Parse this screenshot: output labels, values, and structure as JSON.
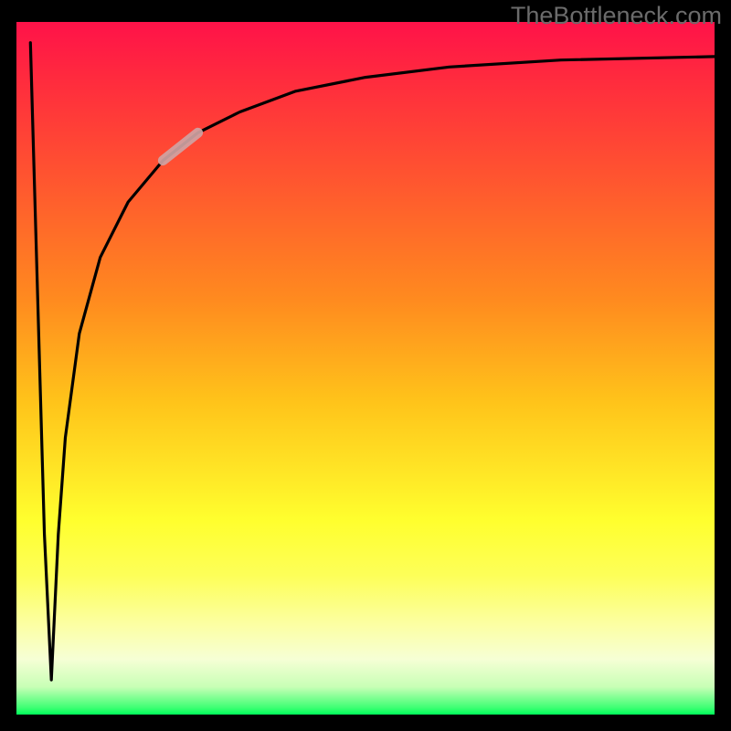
{
  "watermark": "TheBottleneck.com",
  "chart_data": {
    "type": "line",
    "title": "",
    "xlabel": "",
    "ylabel": "",
    "xlim": [
      0,
      100
    ],
    "ylim": [
      0,
      100
    ],
    "grid": false,
    "legend": false,
    "series": [
      {
        "name": "main-curve",
        "x": [
          2,
          4,
          5,
          6,
          7,
          9,
          12,
          16,
          21,
          26,
          32,
          40,
          50,
          62,
          78,
          100
        ],
        "y": [
          97,
          26,
          5,
          26,
          40,
          55,
          66,
          74,
          80,
          84,
          87,
          90,
          92,
          93.5,
          94.5,
          95
        ]
      },
      {
        "name": "highlight-segment",
        "x": [
          21,
          26
        ],
        "y": [
          80,
          84
        ]
      }
    ],
    "background_gradient": {
      "direction": "vertical",
      "stops": [
        {
          "pos": 0.0,
          "color": "#ff1249"
        },
        {
          "pos": 0.08,
          "color": "#ff2a3e"
        },
        {
          "pos": 0.22,
          "color": "#ff5330"
        },
        {
          "pos": 0.4,
          "color": "#ff8a1f"
        },
        {
          "pos": 0.55,
          "color": "#ffc41a"
        },
        {
          "pos": 0.65,
          "color": "#ffe626"
        },
        {
          "pos": 0.72,
          "color": "#ffff2e"
        },
        {
          "pos": 0.8,
          "color": "#fdff59"
        },
        {
          "pos": 0.87,
          "color": "#fcffa3"
        },
        {
          "pos": 0.92,
          "color": "#f6ffd5"
        },
        {
          "pos": 0.96,
          "color": "#c8ffb6"
        },
        {
          "pos": 0.99,
          "color": "#3eff73"
        },
        {
          "pos": 1.0,
          "color": "#00ff5a"
        }
      ]
    },
    "annotations": []
  }
}
